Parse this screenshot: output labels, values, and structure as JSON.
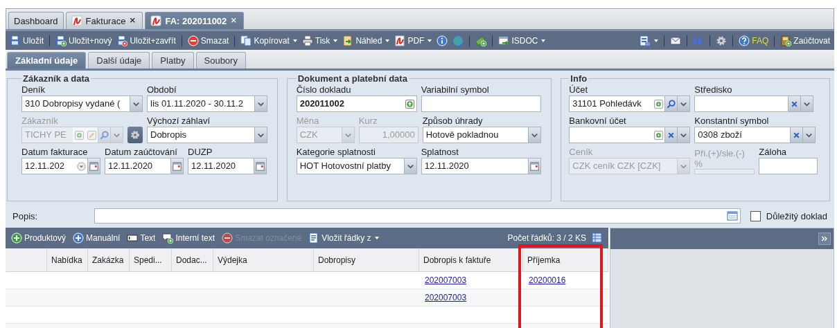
{
  "tabs": [
    {
      "label": "Dashboard",
      "kind": "plain",
      "closable": false,
      "selected": false
    },
    {
      "label": "Fakturace",
      "kind": "document",
      "closable": true,
      "selected": false
    },
    {
      "label": "FA: 202011002",
      "kind": "document",
      "closable": true,
      "selected": true
    }
  ],
  "toolbar": {
    "left": [
      {
        "kind": "save",
        "label": "Uložit",
        "dropdown": false
      },
      {
        "kind": "separator"
      },
      {
        "kind": "save-new",
        "label": "Uložit+nový",
        "dropdown": false
      },
      {
        "kind": "save-close",
        "label": "Uložit+zavřít",
        "dropdown": false
      },
      {
        "kind": "separator"
      },
      {
        "kind": "delete",
        "label": "Smazat",
        "dropdown": false
      },
      {
        "kind": "separator"
      },
      {
        "kind": "copy",
        "label": "Kopírovat",
        "dropdown": true
      },
      {
        "kind": "print",
        "label": "Tisk",
        "dropdown": true
      },
      {
        "kind": "preview",
        "label": "Náhled",
        "dropdown": true
      },
      {
        "kind": "pdf",
        "label": "PDF",
        "dropdown": true
      },
      {
        "kind": "info",
        "dropdown": false
      },
      {
        "kind": "globe",
        "dropdown": false
      },
      {
        "kind": "separator"
      },
      {
        "kind": "money",
        "dropdown": false
      },
      {
        "kind": "separator"
      },
      {
        "kind": "isdoc",
        "label": "ISDOC",
        "dropdown": true
      }
    ],
    "right": [
      {
        "kind": "layout",
        "dropdown": true
      },
      {
        "kind": "separator"
      },
      {
        "kind": "mail",
        "dropdown": false
      },
      {
        "kind": "separator"
      },
      {
        "kind": "forward",
        "dropdown": false
      },
      {
        "kind": "separator"
      },
      {
        "kind": "settings",
        "dropdown": false
      },
      {
        "kind": "separator"
      },
      {
        "kind": "help",
        "label": "FAQ",
        "dropdown": false
      },
      {
        "kind": "separator"
      },
      {
        "kind": "post",
        "label": "Zaúčtovat",
        "dropdown": false
      }
    ]
  },
  "subtabs": [
    {
      "label": "Základní údaje",
      "selected": true
    },
    {
      "label": "Další údaje",
      "selected": false
    },
    {
      "label": "Platby",
      "selected": false
    },
    {
      "label": "Soubory",
      "selected": false
    }
  ],
  "sections": [
    {
      "title": "Zákazník a data",
      "rows": [
        [
          {
            "kind": "combo",
            "label": "Deník",
            "value": "310 Dobropisy vydané (",
            "disabled": false,
            "buttons": [
              {
                "kind": "dropdown"
              }
            ]
          },
          {
            "kind": "combo",
            "label": "Období",
            "value": "lis 01.11.2020 - 30.11.2",
            "disabled": false,
            "buttons": [
              {
                "kind": "dropdown"
              }
            ]
          }
        ],
        [
          {
            "kind": "combo",
            "label": "Zákazník",
            "value": "TICHY PE",
            "disabled": true,
            "buttons": [
              {
                "kind": "add"
              },
              {
                "kind": "edit"
              },
              {
                "kind": "search"
              },
              {
                "kind": "dropdown"
              }
            ]
          },
          {
            "kind": "gear"
          },
          {
            "kind": "combo",
            "label": "Výchozí záhlaví",
            "value": "Dobropis",
            "disabled": false,
            "buttons": [
              {
                "kind": "dropdown"
              }
            ]
          }
        ],
        [
          {
            "kind": "date",
            "label": "Datum fakturace",
            "value": "12.11.202",
            "disabled": false,
            "buttons": [
              {
                "kind": "picker"
              },
              {
                "kind": "calendar"
              }
            ]
          },
          {
            "kind": "date",
            "label": "Datum zaúčtování",
            "value": "12.11.2020",
            "disabled": false,
            "buttons": [
              {
                "kind": "calendar"
              }
            ]
          },
          {
            "kind": "date",
            "label": "DUZP",
            "value": "12.11.2020",
            "disabled": false,
            "buttons": [
              {
                "kind": "calendar"
              }
            ]
          }
        ]
      ]
    },
    {
      "title": "Dokument a platební data",
      "rows": [
        [
          {
            "kind": "text",
            "label": "Číslo dokladu",
            "value": "202011002",
            "bold": true,
            "disabled": false,
            "buttons": [
              {
                "kind": "up"
              }
            ]
          },
          {
            "kind": "text",
            "label": "Variabilní symbol",
            "disabled": false
          }
        ],
        [
          {
            "kind": "combo",
            "label": "Měna",
            "value": "CZK",
            "disabled": true,
            "buttons": [
              {
                "kind": "dropdown"
              }
            ]
          },
          {
            "kind": "number",
            "label": "Kurz",
            "value": "1,00000",
            "disabled": true
          },
          {
            "kind": "combo",
            "label": "Způsob úhrady",
            "value": "Hotově pokladnou",
            "disabled": false,
            "buttons": [
              {
                "kind": "dropdown"
              }
            ]
          }
        ],
        [
          {
            "kind": "combo",
            "label": "Kategorie splatnosti",
            "value": "HOT Hotovostní platby",
            "disabled": false,
            "buttons": [
              {
                "kind": "dropdown"
              }
            ]
          },
          {
            "kind": "date",
            "label": "Splatnost",
            "value": "12.11.2020",
            "disabled": false,
            "buttons": [
              {
                "kind": "calendar"
              }
            ]
          }
        ]
      ]
    },
    {
      "title": "Info",
      "rows": [
        [
          {
            "kind": "combo",
            "label": "Účet",
            "value": "31101 Pohledávk",
            "disabled": false,
            "buttons": [
              {
                "kind": "add"
              },
              {
                "kind": "search"
              },
              {
                "kind": "dropdown"
              }
            ]
          },
          {
            "kind": "combo",
            "label": "Středisko",
            "disabled": false,
            "buttons": [
              {
                "kind": "clear"
              },
              {
                "kind": "dropdown"
              }
            ]
          }
        ],
        [
          {
            "kind": "combo",
            "label": "Bankovní účet",
            "disabled": false,
            "buttons": [
              {
                "kind": "add"
              },
              {
                "kind": "clear"
              },
              {
                "kind": "dropdown"
              }
            ]
          },
          {
            "kind": "combo",
            "label": "Konstantní symbol",
            "value": "0308 zboží",
            "disabled": false,
            "buttons": [
              {
                "kind": "clear"
              },
              {
                "kind": "dropdown"
              }
            ]
          }
        ],
        [
          {
            "kind": "combo",
            "label": "Ceník",
            "value": "CZK ceník CZK [CZK]",
            "disabled": true,
            "buttons": [
              {
                "kind": "dropdown"
              }
            ]
          },
          {
            "kind": "slim",
            "label": "Při.(+)/sle.(-) %",
            "disabled": true
          },
          {
            "kind": "text",
            "label": "Záloha",
            "disabled": false
          }
        ]
      ]
    }
  ],
  "description": {
    "label": "Popis:"
  },
  "important": {
    "label": "Důležitý doklad",
    "checked": false
  },
  "grid_toolbar": {
    "items": [
      {
        "kind": "add-product",
        "label": "Produktový",
        "disabled": false,
        "dropdown": false
      },
      {
        "kind": "add-manual",
        "label": "Manuální",
        "disabled": false,
        "dropdown": false
      },
      {
        "kind": "text",
        "label": "Text",
        "disabled": false,
        "dropdown": false
      },
      {
        "kind": "internal-text",
        "label": "Interní text",
        "disabled": false,
        "dropdown": false
      },
      {
        "kind": "delete",
        "label": "Smazat označené",
        "disabled": true,
        "dropdown": false
      },
      {
        "kind": "insert",
        "label": "Vložit řádky z",
        "disabled": false,
        "dropdown": true
      }
    ],
    "row_count": "Počet řádků: 3 / 2 KS"
  },
  "table": {
    "columns": [
      {
        "label": "Nabídka",
        "highlighted": false
      },
      {
        "label": "Zakázka",
        "highlighted": false
      },
      {
        "label": "Spedi...",
        "highlighted": false
      },
      {
        "label": "Dodac...",
        "highlighted": false
      },
      {
        "label": "Výdejka",
        "highlighted": false
      },
      {
        "label": "Dobropisy",
        "highlighted": false
      },
      {
        "label": "Dobropis k faktuře",
        "highlighted": false
      },
      {
        "label": "Příjemka",
        "highlighted": true
      }
    ],
    "rows": [
      [
        null,
        null,
        null,
        null,
        null,
        null,
        "202007003",
        "20200016"
      ],
      [
        null,
        null,
        null,
        null,
        null,
        null,
        "202007003",
        null
      ]
    ]
  }
}
